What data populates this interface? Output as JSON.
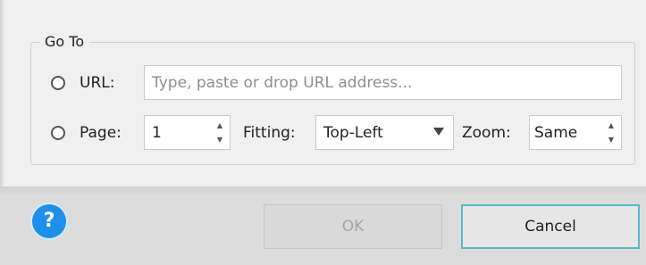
{
  "group": {
    "title": "Go To"
  },
  "url_row": {
    "label": "URL:",
    "placeholder": "Type, paste or drop URL address..."
  },
  "page_row": {
    "label": "Page:",
    "page_value": "1",
    "fitting_label": "Fitting:",
    "fitting_value": "Top-Left",
    "zoom_label": "Zoom:",
    "zoom_value": "Same"
  },
  "buttons": {
    "help_glyph": "?",
    "ok": "OK",
    "cancel": "Cancel"
  },
  "colors": {
    "accent_help": "#1e90ea",
    "focus_border": "#58b9c9"
  },
  "icons": {
    "help": "help-icon",
    "spin_up": "spin-up-arrow-icon",
    "spin_down": "spin-down-arrow-icon",
    "dropdown": "chevron-down-icon"
  }
}
